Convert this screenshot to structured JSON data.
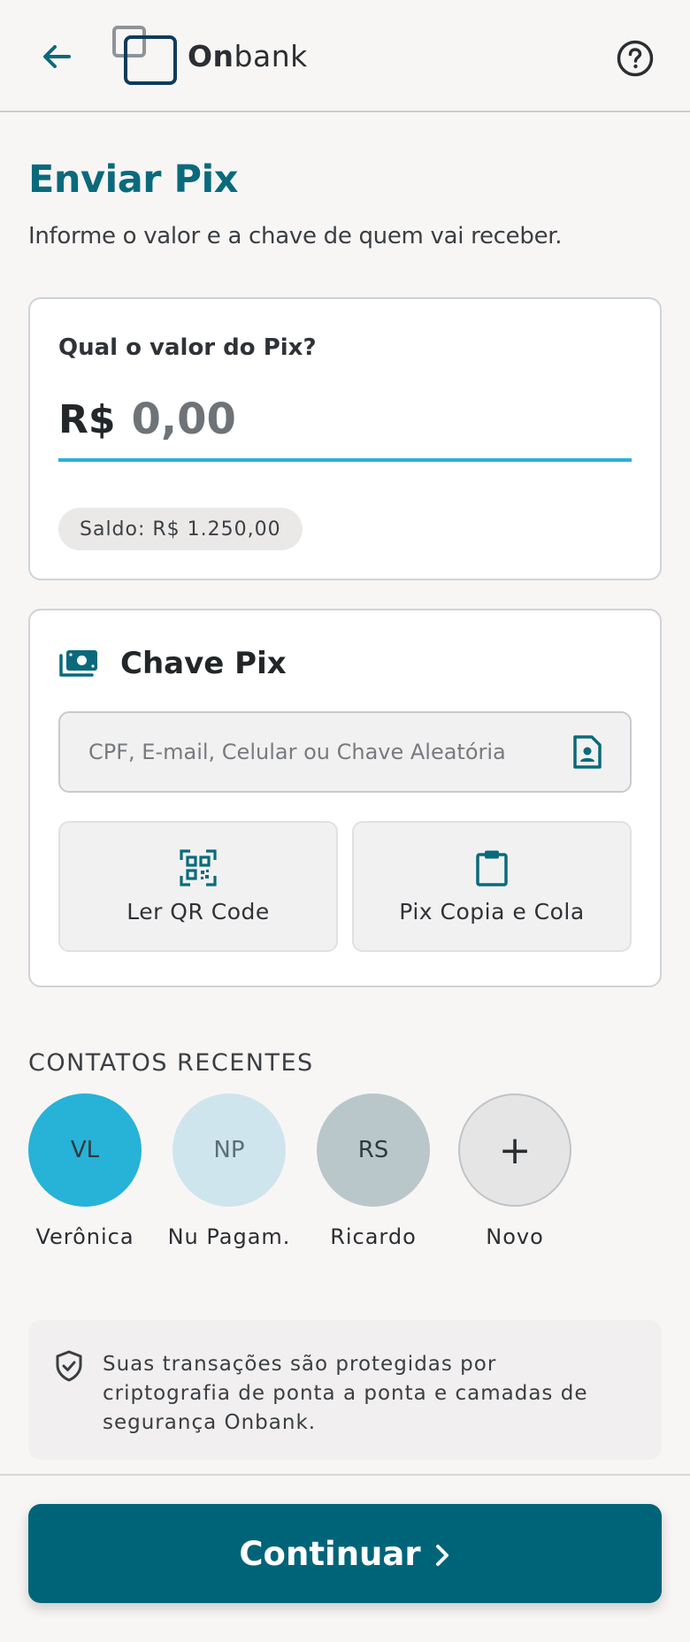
{
  "header": {
    "logo_bold": "On",
    "logo_rest": "bank",
    "back_icon": "arrow-left-icon",
    "help_icon": "help-circle-icon"
  },
  "page": {
    "title": "Enviar Pix",
    "subtitle": "Informe o valor e a chave de quem vai receber."
  },
  "amount": {
    "label": "Qual o valor do Pix?",
    "currency": "R$",
    "placeholder": "0,00",
    "balance": "Saldo: R$ 1.250,00"
  },
  "pix_key": {
    "title": "Chave Pix",
    "placeholder": "CPF, E-mail, Celular ou Chave Aleatória",
    "qr_label": "Ler QR Code",
    "paste_label": "Pix Copia e Cola"
  },
  "recent_contacts": {
    "title": "CONTATOS RECENTES",
    "items": [
      {
        "initials": "VL",
        "name": "Verônica",
        "color": "#27b2d7"
      },
      {
        "initials": "NP",
        "name": "Nu Pagam.",
        "color": "#cfe5ee"
      },
      {
        "initials": "RS",
        "name": "Ricardo",
        "color": "#b9c7cb"
      },
      {
        "initials": "+",
        "name": "Novo",
        "color": "#e6e5e5"
      }
    ]
  },
  "security": {
    "text": "Suas transações são protegidas por criptografia de ponta a ponta e camadas de segurança Onbank."
  },
  "footer": {
    "continue_label": "Continuar"
  },
  "colors": {
    "primary": "#006479",
    "accent": "#27b2d7",
    "title": "#0a6a7c"
  }
}
